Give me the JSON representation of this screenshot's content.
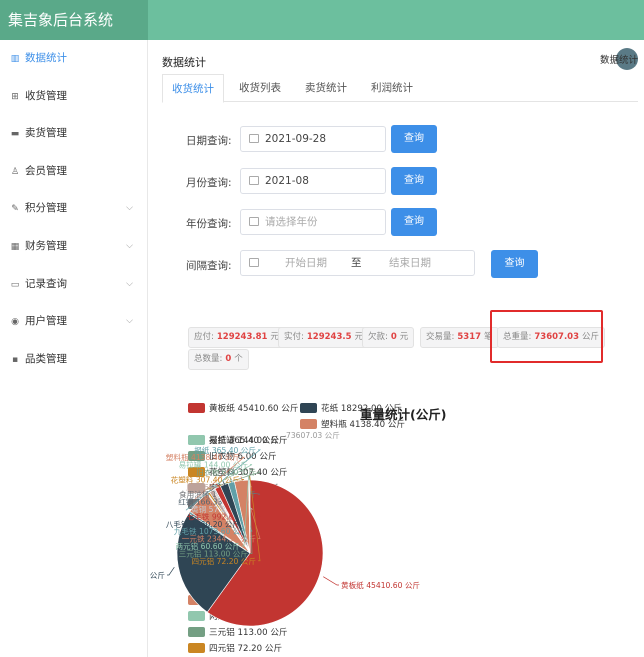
{
  "app": {
    "title": "集吉象后台系统"
  },
  "sidebar": {
    "items": [
      {
        "label": "数据统计",
        "icon": "bar-chart-icon",
        "glyph": "▥",
        "active": true,
        "expandable": false
      },
      {
        "label": "收货管理",
        "icon": "cart-icon",
        "glyph": "⊞",
        "active": false,
        "expandable": false
      },
      {
        "label": "卖货管理",
        "icon": "truck-icon",
        "glyph": "▬",
        "active": false,
        "expandable": false
      },
      {
        "label": "会员管理",
        "icon": "user-icon",
        "glyph": "♙",
        "active": false,
        "expandable": false
      },
      {
        "label": "积分管理",
        "icon": "edit-icon",
        "glyph": "✎",
        "active": false,
        "expandable": true
      },
      {
        "label": "财务管理",
        "icon": "calculator-icon",
        "glyph": "▦",
        "active": false,
        "expandable": true
      },
      {
        "label": "记录查询",
        "icon": "folder-icon",
        "glyph": "▭",
        "active": false,
        "expandable": true
      },
      {
        "label": "用户管理",
        "icon": "user-circle-icon",
        "glyph": "◉",
        "active": false,
        "expandable": true
      },
      {
        "label": "品类管理",
        "icon": "grid-icon",
        "glyph": "▪",
        "active": false,
        "expandable": false
      }
    ]
  },
  "page": {
    "title": "数据统计",
    "breadcrumb_sep": "/",
    "breadcrumb_text": "数据统计"
  },
  "tabs": [
    {
      "label": "收货统计",
      "active": true
    },
    {
      "label": "收货列表",
      "active": false
    },
    {
      "label": "卖货统计",
      "active": false
    },
    {
      "label": "利润统计",
      "active": false
    }
  ],
  "query": {
    "button": "查询",
    "date": {
      "label": "日期查询:",
      "value": "2021-09-28"
    },
    "month": {
      "label": "月份查询:",
      "value": "2021-08"
    },
    "year": {
      "label": "年份查询:",
      "placeholder": "请选择年份"
    },
    "range": {
      "label": "间隔查询:",
      "start_placeholder": "开始日期",
      "separator": "至",
      "end_placeholder": "结束日期"
    }
  },
  "stats": {
    "payable": {
      "label": "应付:",
      "value": "129243.81",
      "unit": "元"
    },
    "paid": {
      "label": "实付:",
      "value": "129243.5",
      "unit": "元"
    },
    "owed": {
      "label": "欠款:",
      "value": "0",
      "unit": "元"
    },
    "trades": {
      "label": "交易量:",
      "value": "5317",
      "unit": "笔"
    },
    "total_weight": {
      "label": "总重量:",
      "value": "73607.03",
      "unit": "公斤"
    },
    "total_count": {
      "label": "总数量:",
      "value": "0",
      "unit": "个"
    }
  },
  "chart_data": {
    "type": "pie",
    "title": "重量统计(公斤)",
    "unit": "公斤",
    "series": [
      {
        "name": "黄板纸",
        "value": 45410.6,
        "color": "#c23531"
      },
      {
        "name": "花纸",
        "value": 18292.0,
        "color": "#2f4554"
      },
      {
        "name": "报纸",
        "value": 365.4,
        "color": "#61a0a8"
      },
      {
        "name": "塑料瓶",
        "value": 4138.4,
        "color": "#d48265"
      },
      {
        "name": "易拉罐",
        "value": 144.0,
        "color": "#91c7ae"
      },
      {
        "name": "旧衣物",
        "value": 6.0,
        "color": "#749f83"
      },
      {
        "name": "花塑料",
        "value": 307.4,
        "color": "#ca8622"
      },
      {
        "name": "废铁",
        "value": 653.6,
        "color": "#bda29a"
      },
      {
        "name": "食用油桶",
        "value": 171.8,
        "color": "#6e7074"
      },
      {
        "name": "红铜",
        "value": 166.33,
        "color": "#546570"
      },
      {
        "name": "黄铜",
        "value": 57.2,
        "color": "#c4ccd3"
      },
      {
        "name": "七毛铁",
        "value": 992.6,
        "color": "#c23531"
      },
      {
        "name": "八毛铁",
        "value": 1360.2,
        "color": "#2f4554"
      },
      {
        "name": "九毛铁",
        "value": 1073.6,
        "color": "#61a0a8"
      },
      {
        "name": "一元铁",
        "value": 2344.5,
        "color": "#d48265"
      },
      {
        "name": "两元铝",
        "value": 60.6,
        "color": "#91c7ae"
      },
      {
        "name": "三元铝",
        "value": 113.0,
        "color": "#749f83"
      },
      {
        "name": "四元铝",
        "value": 72.2,
        "color": "#ca8622"
      }
    ],
    "total_label": "73607.03 公斤",
    "legend_placement": "left"
  }
}
